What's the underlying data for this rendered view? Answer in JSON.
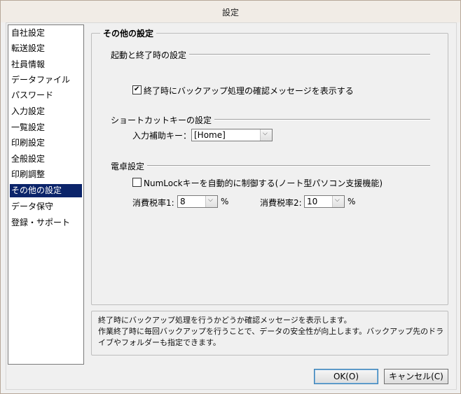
{
  "window": {
    "title": "設定"
  },
  "sidebar": {
    "items": [
      {
        "label": "自社設定"
      },
      {
        "label": "転送設定"
      },
      {
        "label": "社員情報"
      },
      {
        "label": "データファイル"
      },
      {
        "label": "パスワード"
      },
      {
        "label": "入力設定"
      },
      {
        "label": "一覧設定"
      },
      {
        "label": "印刷設定"
      },
      {
        "label": "全般設定"
      },
      {
        "label": "印刷調整"
      },
      {
        "label": "その他の設定",
        "selected": true
      },
      {
        "label": "データ保守"
      },
      {
        "label": "登録・サポート"
      }
    ]
  },
  "main": {
    "title": "その他の設定",
    "startup": {
      "title": "起動と終了時の設定",
      "backup_confirm_label": "終了時にバックアップ処理の確認メッセージを表示する",
      "backup_confirm_checked": true
    },
    "shortcut": {
      "title": "ショートカットキーの設定",
      "input_assist_label": "入力補助キー：",
      "input_assist_value": "[Home]"
    },
    "calculator": {
      "title": "電卓設定",
      "numlock_label": "NumLockキーを自動的に制御する(ノート型パソコン支援機能)",
      "numlock_checked": false,
      "tax1_label": "消費税率1:",
      "tax1_value": "8",
      "tax2_label": "消費税率2:",
      "tax2_value": "10",
      "unit": "%"
    }
  },
  "description": {
    "line1": "終了時にバックアップ処理を行うかどうか確認メッセージを表示します。",
    "line2": "作業終了時に毎回バックアップを行うことで、データの安全性が向上します。バックアップ先のドラ",
    "line3": "イブやフォルダーも指定できます。"
  },
  "buttons": {
    "ok": "OK(O)",
    "cancel": "キャンセル(C)"
  }
}
